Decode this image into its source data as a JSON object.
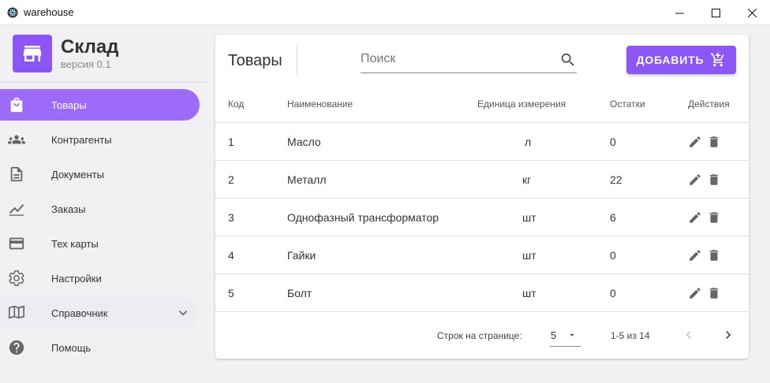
{
  "window": {
    "title": "warehouse"
  },
  "brand": {
    "title": "Склад",
    "version": "версия 0.1"
  },
  "sidebar": {
    "items": [
      {
        "label": "Товары",
        "icon": "shopping-bag-icon"
      },
      {
        "label": "Контрагенты",
        "icon": "people-icon"
      },
      {
        "label": "Документы",
        "icon": "document-icon"
      },
      {
        "label": "Заказы",
        "icon": "chart-line-icon"
      },
      {
        "label": "Тех карты",
        "icon": "card-icon"
      },
      {
        "label": "Настройки",
        "icon": "gear-icon"
      },
      {
        "label": "Справочник",
        "icon": "book-icon"
      },
      {
        "label": "Помощь",
        "icon": "help-icon"
      }
    ]
  },
  "main": {
    "title": "Товары",
    "search_placeholder": "Поиск",
    "add_button": "ДОБАВИТЬ",
    "columns": [
      "Код",
      "Наименование",
      "Единица измерения",
      "Остатки",
      "Действия"
    ],
    "rows": [
      {
        "code": "1",
        "name": "Масло",
        "unit": "л",
        "stock": "0"
      },
      {
        "code": "2",
        "name": "Металл",
        "unit": "кг",
        "stock": "22"
      },
      {
        "code": "3",
        "name": "Однофазный трансформатор",
        "unit": "шт",
        "stock": "6"
      },
      {
        "code": "4",
        "name": "Гайки",
        "unit": "шт",
        "stock": "0"
      },
      {
        "code": "5",
        "name": "Болт",
        "unit": "шт",
        "stock": "0"
      }
    ],
    "pagination": {
      "rows_per_page_label": "Строк на странице:",
      "rows_per_page": "5",
      "range": "1-5 из 14"
    }
  },
  "colors": {
    "accent": "#8c56f7",
    "active_nav": "#9d6bf9"
  }
}
